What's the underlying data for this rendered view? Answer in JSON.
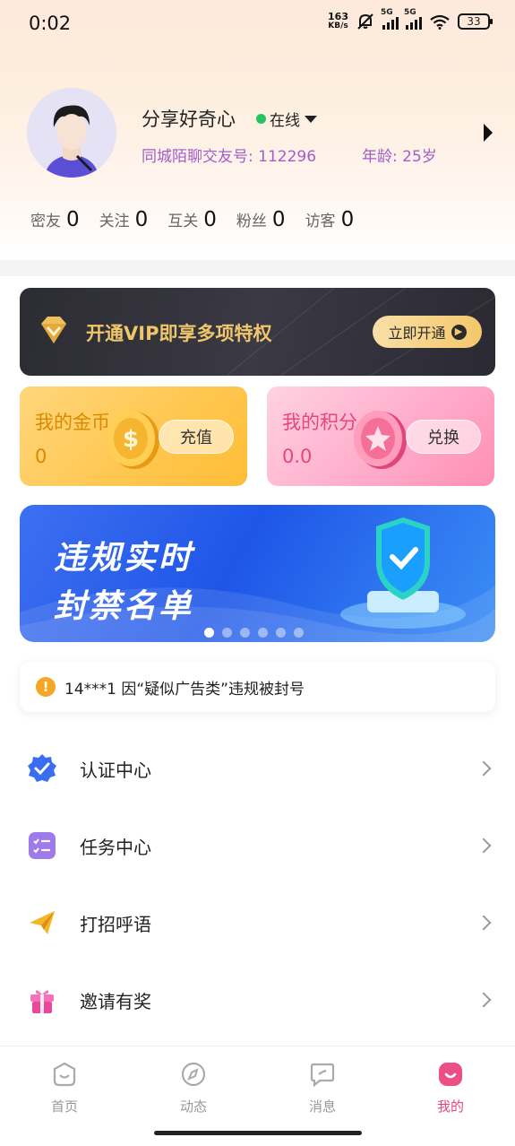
{
  "status_bar": {
    "time": "0:02",
    "net_speed_value": "163",
    "net_speed_unit": "KB/s",
    "signal1_label": "5G",
    "signal2_label": "5G",
    "battery": "33"
  },
  "profile": {
    "nickname": "分享好奇心",
    "status": "在线",
    "account_id": "同城陌聊交友号: 112296",
    "age": "年龄: 25岁"
  },
  "stats": [
    {
      "label": "密友",
      "value": "0"
    },
    {
      "label": "关注",
      "value": "0"
    },
    {
      "label": "互关",
      "value": "0"
    },
    {
      "label": "粉丝",
      "value": "0"
    },
    {
      "label": "访客",
      "value": "0"
    }
  ],
  "vip": {
    "text": "开通VIP即享多项特权",
    "button": "立即开通"
  },
  "coins": {
    "title": "我的金币",
    "value": "0",
    "button": "充值"
  },
  "points": {
    "title": "我的积分",
    "value": "0.0",
    "button": "兑换"
  },
  "promo": {
    "line1": "违规实时",
    "line2": "封禁名单",
    "active_slide": 1,
    "slide_count": 6
  },
  "notice": {
    "text": "14***1 因“疑似广告类”违规被封号"
  },
  "menu": [
    {
      "label": "认证中心",
      "icon": "verified-badge-icon"
    },
    {
      "label": "任务中心",
      "icon": "task-list-icon"
    },
    {
      "label": "打招呼语",
      "icon": "paper-plane-icon"
    },
    {
      "label": "邀请有奖",
      "icon": "gift-icon"
    }
  ],
  "nav": [
    {
      "label": "首页",
      "icon": "home-icon"
    },
    {
      "label": "动态",
      "icon": "compass-icon"
    },
    {
      "label": "消息",
      "icon": "message-icon"
    },
    {
      "label": "我的",
      "icon": "profile-icon",
      "active": true
    }
  ],
  "colors": {
    "accent_pink": "#e8457b",
    "accent_purple": "#a35cc9",
    "vip_gold": "#f0c66a",
    "online_green": "#22c55e"
  }
}
